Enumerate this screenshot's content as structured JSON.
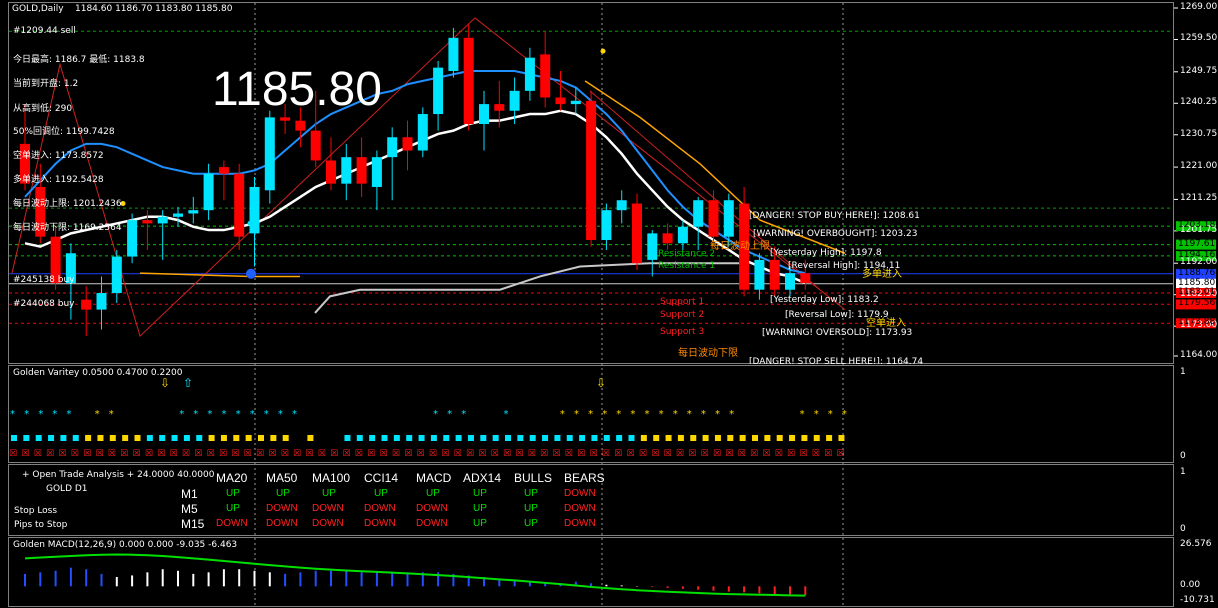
{
  "header": {
    "symbol": "GOLD,Daily",
    "ohlc": "1184.60 1186.70 1183.80 1185.80"
  },
  "big_price": "1185.80",
  "info_lines": [
    "#1209.44 sell",
    "今日最高: 1186.7   最低: 1183.8",
    "当前到开盘: 1.2",
    "从高到低: 290",
    "50%回调位: 1199.7428",
    "空单进入: 1173.8572",
    "多单进入: 1192.5428",
    "每日波动上限: 1201.2436",
    "每日波动下限: 1169.2564",
    "#245138 buy",
    "#244068 buy"
  ],
  "annotations": {
    "danger_buy": "[DANGER! STOP BUY HERE!]: 1208.61",
    "warn_overbought": "[WARNING! OVERBOUGHT]: 1203.23",
    "upper_limit": "每日波动上限",
    "yesterday_high": "[Yesterday High]: 1197.8",
    "reversal_high": "[Reversal High]: 1194.11",
    "buy_entry": "多单进入",
    "resistance2": "Resistance 2",
    "resistance1": "Resistance 1",
    "yesterday_low": "[Yesterday Low]: 1183.2",
    "support1": "Support 1",
    "support2": "Support 2",
    "support3": "Support 3",
    "reversal_low": "[Reversal Low]: 1179.9",
    "sell_entry": "空单进入",
    "warn_oversold": "[WARNING! OVERSOLD]: 1173.93",
    "lower_limit": "每日波动下限",
    "danger_sell": "[DANGER! STOP SELL HERE!]: 1164.74"
  },
  "price_axis": {
    "ticks": [
      "1269.00",
      "1259.50",
      "1249.75",
      "1240.25",
      "1230.75",
      "1221.00",
      "1211.25",
      "1201.75",
      "1192.00",
      "1182.50",
      "1173.00",
      "1164.00"
    ],
    "tags": [
      {
        "label": "1203.18",
        "color": "#00c000"
      },
      {
        "label": "1197.61",
        "color": "#00c000"
      },
      {
        "label": "1194.16",
        "color": "#00c000"
      },
      {
        "label": "1188.76",
        "color": "#2040ff"
      },
      {
        "label": "1185.80",
        "color": "#ffffff"
      },
      {
        "label": "1183.01",
        "color": "#ff0000"
      },
      {
        "label": "1179.56",
        "color": "#ff0000"
      },
      {
        "label": "1173.88",
        "color": "#ff0000"
      }
    ]
  },
  "chart_data": {
    "type": "candlestick",
    "ylim": [
      1164,
      1269
    ],
    "candles": [
      {
        "o": 1228,
        "h": 1240,
        "l": 1214,
        "c": 1216
      },
      {
        "o": 1215,
        "h": 1222,
        "l": 1198,
        "c": 1200
      },
      {
        "o": 1200,
        "h": 1203,
        "l": 1184,
        "c": 1186
      },
      {
        "o": 1186,
        "h": 1198,
        "l": 1175,
        "c": 1195
      },
      {
        "o": 1181,
        "h": 1185,
        "l": 1170,
        "c": 1178
      },
      {
        "o": 1178,
        "h": 1188,
        "l": 1172,
        "c": 1183
      },
      {
        "o": 1183,
        "h": 1196,
        "l": 1180,
        "c": 1194
      },
      {
        "o": 1194,
        "h": 1207,
        "l": 1192,
        "c": 1205
      },
      {
        "o": 1205,
        "h": 1208,
        "l": 1196,
        "c": 1204
      },
      {
        "o": 1204,
        "h": 1208,
        "l": 1193,
        "c": 1206
      },
      {
        "o": 1206,
        "h": 1209,
        "l": 1203,
        "c": 1207
      },
      {
        "o": 1207,
        "h": 1212,
        "l": 1204,
        "c": 1208
      },
      {
        "o": 1208,
        "h": 1222,
        "l": 1205,
        "c": 1219
      },
      {
        "o": 1221,
        "h": 1223,
        "l": 1211,
        "c": 1219
      },
      {
        "o": 1219,
        "h": 1222,
        "l": 1196,
        "c": 1200
      },
      {
        "o": 1201,
        "h": 1218,
        "l": 1191,
        "c": 1215
      },
      {
        "o": 1214,
        "h": 1238,
        "l": 1210,
        "c": 1236
      },
      {
        "o": 1236,
        "h": 1240,
        "l": 1231,
        "c": 1235
      },
      {
        "o": 1235,
        "h": 1239,
        "l": 1227,
        "c": 1232
      },
      {
        "o": 1232,
        "h": 1244,
        "l": 1221,
        "c": 1223
      },
      {
        "o": 1223,
        "h": 1230,
        "l": 1214,
        "c": 1216
      },
      {
        "o": 1216,
        "h": 1228,
        "l": 1211,
        "c": 1224
      },
      {
        "o": 1224,
        "h": 1230,
        "l": 1212,
        "c": 1216
      },
      {
        "o": 1215,
        "h": 1226,
        "l": 1208,
        "c": 1224
      },
      {
        "o": 1224,
        "h": 1233,
        "l": 1211,
        "c": 1230
      },
      {
        "o": 1230,
        "h": 1235,
        "l": 1220,
        "c": 1226
      },
      {
        "o": 1226,
        "h": 1239,
        "l": 1224,
        "c": 1237
      },
      {
        "o": 1237,
        "h": 1253,
        "l": 1232,
        "c": 1251
      },
      {
        "o": 1250,
        "h": 1263,
        "l": 1248,
        "c": 1260
      },
      {
        "o": 1260,
        "h": 1264,
        "l": 1232,
        "c": 1234
      },
      {
        "o": 1234,
        "h": 1244,
        "l": 1226,
        "c": 1240
      },
      {
        "o": 1240,
        "h": 1247,
        "l": 1233,
        "c": 1238
      },
      {
        "o": 1238,
        "h": 1248,
        "l": 1234,
        "c": 1244
      },
      {
        "o": 1244,
        "h": 1257,
        "l": 1241,
        "c": 1254
      },
      {
        "o": 1255,
        "h": 1262,
        "l": 1239,
        "c": 1242
      },
      {
        "o": 1242,
        "h": 1250,
        "l": 1238,
        "c": 1240
      },
      {
        "o": 1240,
        "h": 1245,
        "l": 1237,
        "c": 1241
      },
      {
        "o": 1241,
        "h": 1244,
        "l": 1197,
        "c": 1199
      },
      {
        "o": 1199,
        "h": 1210,
        "l": 1196,
        "c": 1208
      },
      {
        "o": 1208,
        "h": 1214,
        "l": 1204,
        "c": 1211
      },
      {
        "o": 1210,
        "h": 1213,
        "l": 1190,
        "c": 1192
      },
      {
        "o": 1193,
        "h": 1202,
        "l": 1188,
        "c": 1201
      },
      {
        "o": 1201,
        "h": 1204,
        "l": 1196,
        "c": 1198
      },
      {
        "o": 1198,
        "h": 1205,
        "l": 1196,
        "c": 1203
      },
      {
        "o": 1203,
        "h": 1212,
        "l": 1196,
        "c": 1211
      },
      {
        "o": 1211,
        "h": 1214,
        "l": 1198,
        "c": 1200
      },
      {
        "o": 1200,
        "h": 1213,
        "l": 1197,
        "c": 1211
      },
      {
        "o": 1210,
        "h": 1215,
        "l": 1182,
        "c": 1184
      },
      {
        "o": 1184,
        "h": 1195,
        "l": 1181,
        "c": 1193
      },
      {
        "o": 1193,
        "h": 1197,
        "l": 1182,
        "c": 1184
      },
      {
        "o": 1184,
        "h": 1191,
        "l": 1182,
        "c": 1189
      },
      {
        "o": 1189,
        "h": 1193,
        "l": 1184,
        "c": 1186
      }
    ],
    "ma_white": [
      1198,
      1197,
      1199,
      1201,
      1202,
      1203,
      1204,
      1205,
      1206,
      1206,
      1205,
      1203,
      1202,
      1202,
      1203,
      1204,
      1206,
      1209,
      1212,
      1215,
      1217,
      1219,
      1221,
      1223,
      1225,
      1227,
      1229,
      1231,
      1232,
      1234,
      1235,
      1235,
      1236,
      1237,
      1237,
      1238,
      1237,
      1234,
      1230,
      1225,
      1219,
      1214,
      1209,
      1205,
      1202,
      1199,
      1196,
      1193,
      1191,
      1189,
      1188,
      1186
    ],
    "ma_blue": [
      1212,
      1217,
      1222,
      1226,
      1228,
      1228,
      1227,
      1225,
      1223,
      1221,
      1220,
      1219,
      1219,
      1219,
      1219,
      1220,
      1222,
      1226,
      1230,
      1234,
      1237,
      1239,
      1241,
      1243,
      1244,
      1246,
      1247,
      1248,
      1249,
      1250,
      1250,
      1250,
      1250,
      1249,
      1248,
      1247,
      1245,
      1241,
      1237,
      1232,
      1226,
      1220,
      1214,
      1209,
      1205,
      1202,
      1199,
      1196,
      1194,
      1192,
      1190,
      1189
    ],
    "macd": [
      8,
      9,
      10,
      12,
      11,
      8,
      6,
      7,
      9,
      11,
      10,
      8,
      9,
      11,
      11,
      10,
      9,
      8,
      9,
      10,
      10,
      10,
      9,
      9,
      9,
      9,
      9,
      9,
      8,
      7,
      6,
      5,
      4,
      3,
      2,
      2,
      3,
      2,
      1,
      0.6,
      0.2,
      -0.5,
      -1,
      -1.6,
      -2.2,
      -2.8,
      -3.4,
      -3.9,
      -4.5,
      -5,
      -5.4,
      -5.8
    ],
    "macd_signal": [
      18,
      18.5,
      19,
      19.5,
      20,
      20.3,
      20.5,
      20.3,
      20,
      19.5,
      18.8,
      18,
      17.2,
      16.3,
      15.4,
      14.5,
      13.6,
      12.8,
      12,
      11.3,
      10.7,
      10.2,
      9.7,
      9.3,
      8.8,
      8.3,
      7.8,
      7.2,
      6.6,
      5.9,
      5.2,
      4.5,
      3.8,
      3,
      2.2,
      1.4,
      0.5,
      -0.4,
      -1.2,
      -1.9,
      -2.5,
      -3,
      -3.5,
      -3.9,
      -4.3,
      -4.7,
      -5,
      -5.2,
      -5.4,
      -5.6,
      -5.8,
      -6
    ]
  },
  "colors": {
    "bull": "#00e5ff",
    "bear": "#ff0000",
    "ma_white": "#ffffff",
    "ma_blue": "#1e90ff",
    "ma_orange": "#ffa500"
  },
  "variety": {
    "title": "Golden Varitey 0.0500 0.4700 0.2200",
    "axis_top": "1",
    "axis_bottom": "0",
    "arrow_up": "⇧",
    "arrow_down": "⇩",
    "star": "*",
    "x_mark": "☒",
    "star_pattern": "ccccc0yy0000ccccccccc000000000ccc00c000yyyyyyyyyyyyy0000yyyy",
    "square_pattern": "ccccccyyyyycccccyyyyyyy0y00ccccccccccccccccccccccccyyyyyyyyyyyyyyyyy"
  },
  "analysis": {
    "title": "+ Open Trade Analysis + 24.0000 40.0000",
    "subtitle": "GOLD  D1",
    "stop_loss": "Stop Loss",
    "pips_to_stop": "Pips to Stop",
    "axis_top": "1",
    "axis_bottom": "0",
    "columns": [
      "MA20",
      "MA50",
      "MA100",
      "CCI14",
      "MACD",
      "ADX14",
      "BULLS",
      "BEARS"
    ],
    "rows": [
      {
        "tf": "M1",
        "vals": [
          "UP",
          "UP",
          "UP",
          "UP",
          "UP",
          "UP",
          "UP",
          "DOWN"
        ]
      },
      {
        "tf": "M5",
        "vals": [
          "UP",
          "DOWN",
          "DOWN",
          "DOWN",
          "DOWN",
          "UP",
          "UP",
          "DOWN"
        ]
      },
      {
        "tf": "M15",
        "vals": [
          "DOWN",
          "DOWN",
          "DOWN",
          "DOWN",
          "DOWN",
          "UP",
          "UP",
          "DOWN"
        ]
      }
    ]
  },
  "macd_panel": {
    "title": "Golden MACD(12,26,9) 0.000 0.000 -9.035 -6.463",
    "ticks": [
      "26.576",
      "0.00",
      "-10.731"
    ]
  }
}
